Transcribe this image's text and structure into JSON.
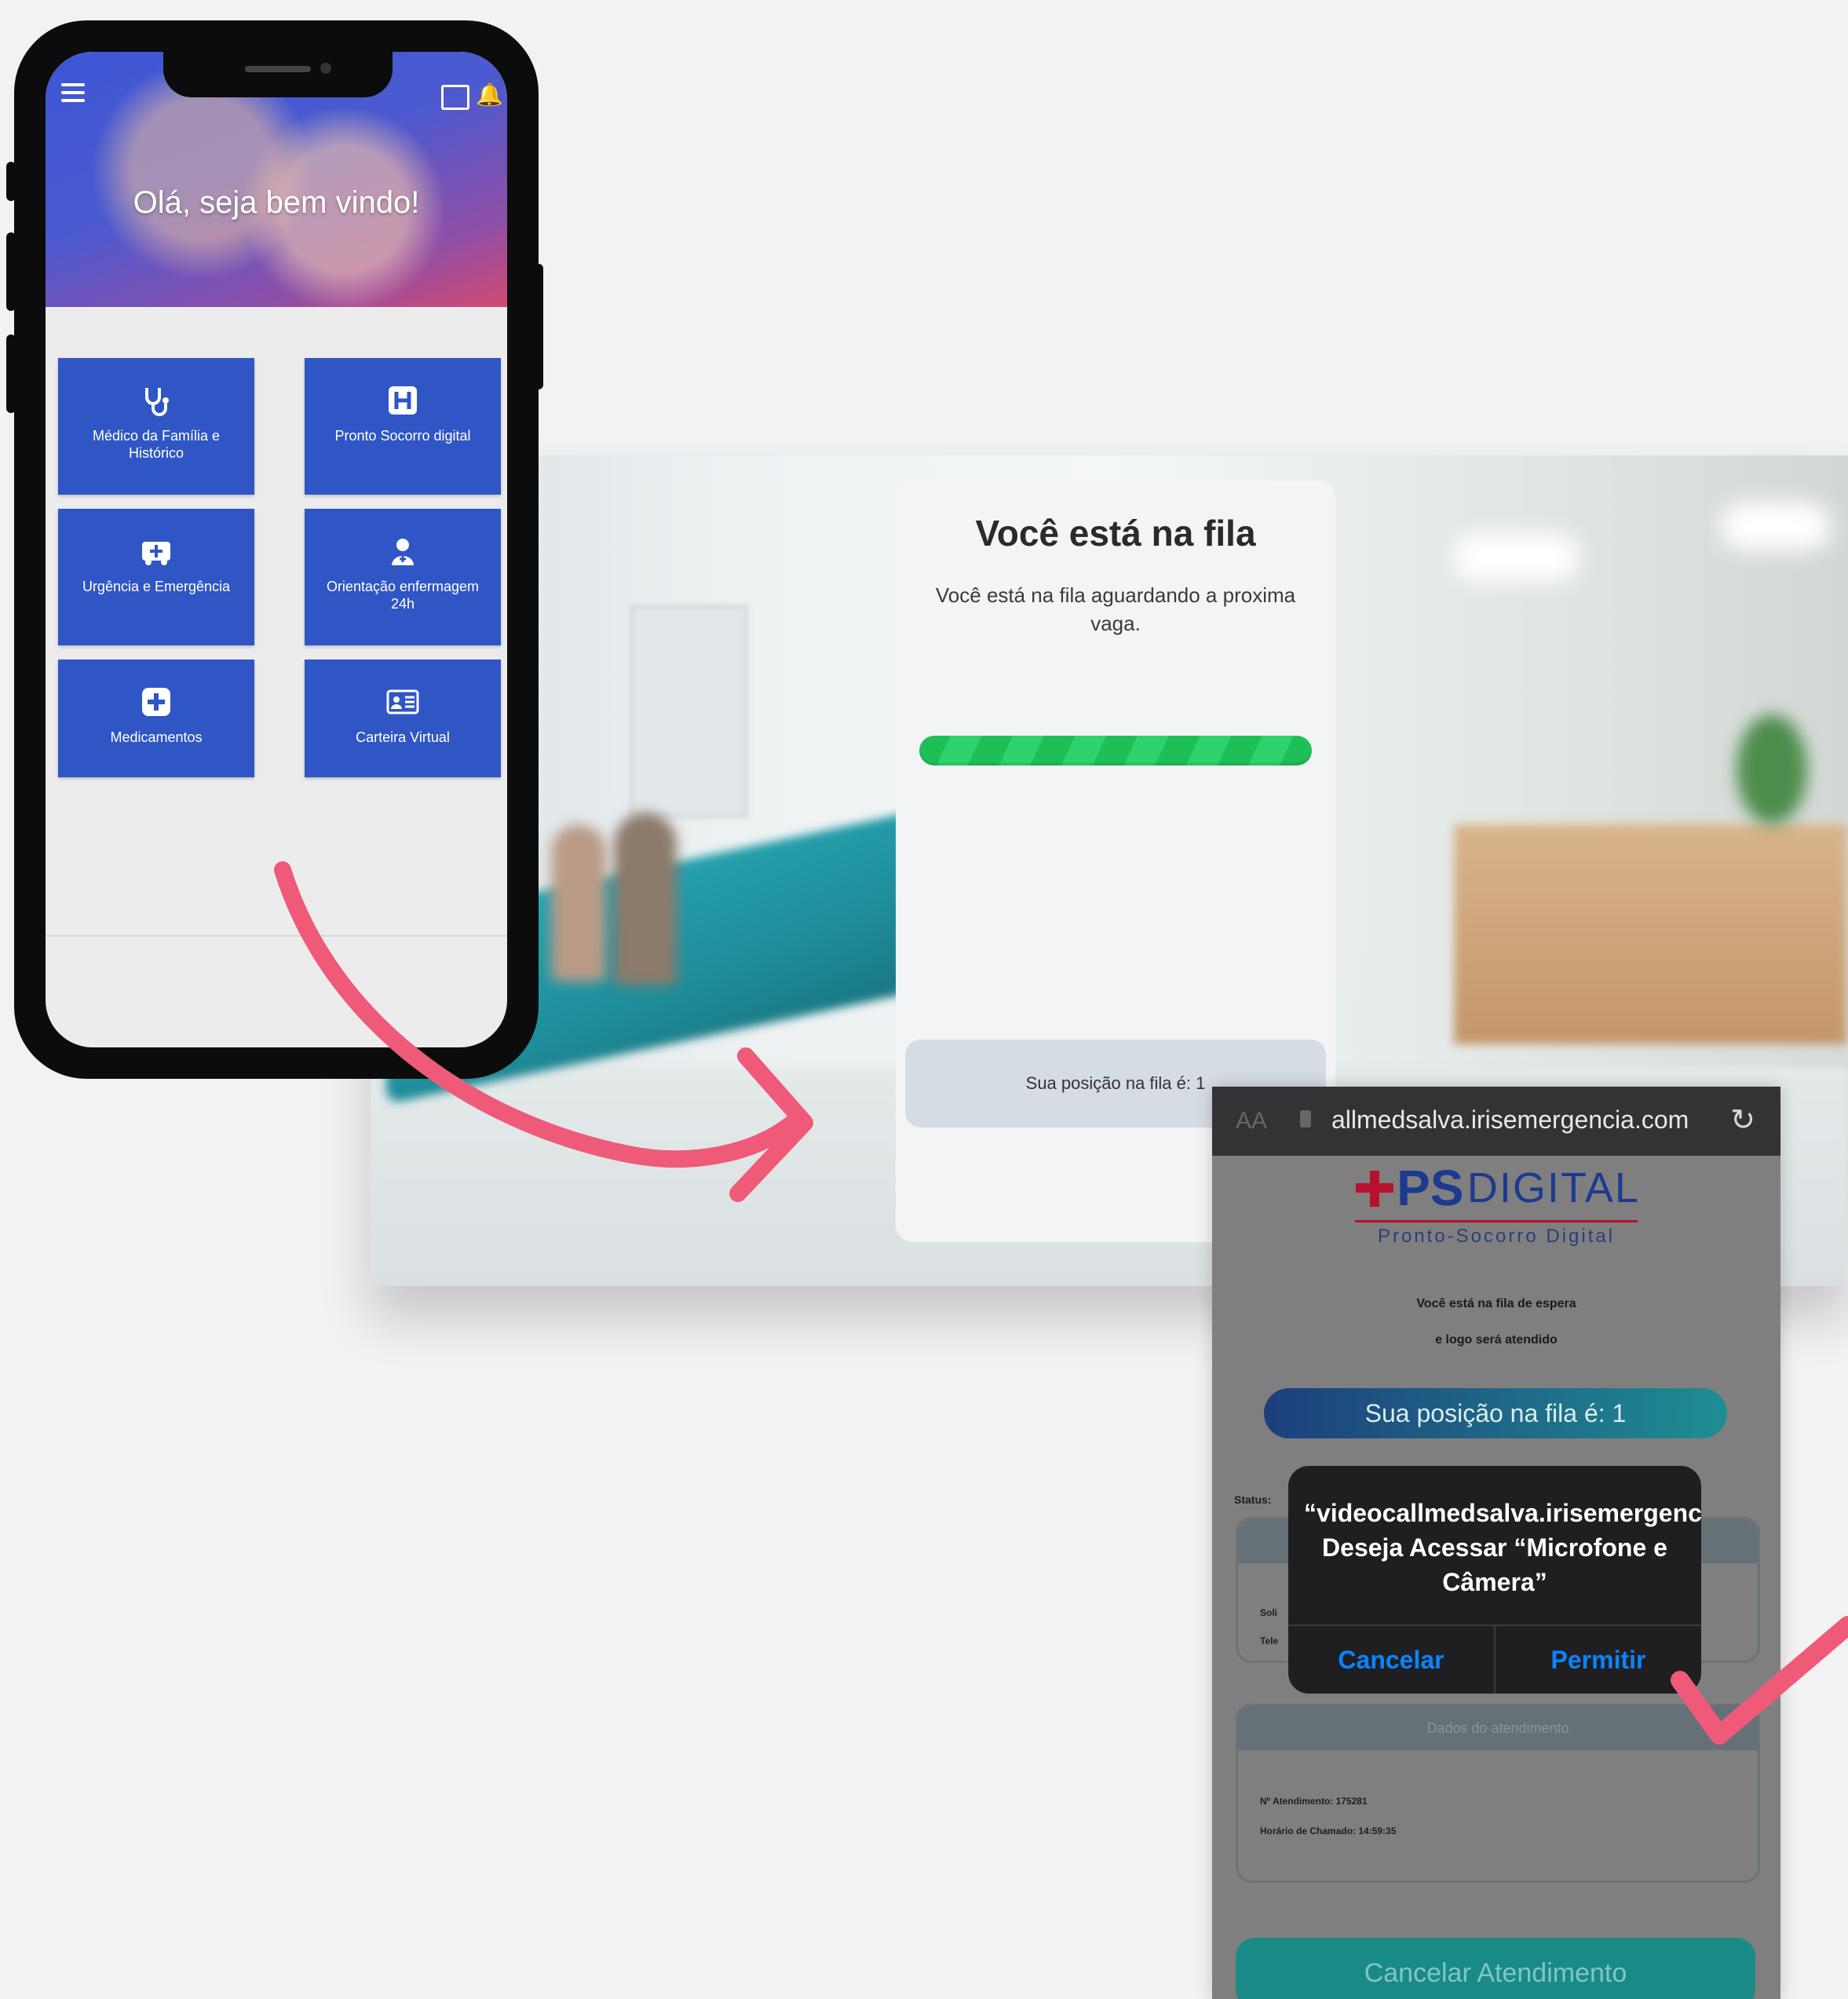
{
  "phone": {
    "greeting": "Olá, seja bem vindo!",
    "tiles": [
      {
        "label": "Médico da Família e Histórico",
        "icon": "stethoscope-icon"
      },
      {
        "label": "Pronto Socorro digital",
        "icon": "hospital-icon"
      },
      {
        "label": "Urgência e Emergência",
        "icon": "ambulance-icon"
      },
      {
        "label": "Orientação enfermagem 24h",
        "icon": "nurse-icon"
      },
      {
        "label": "Medicamentos",
        "icon": "medicine-plus-icon"
      },
      {
        "label": "Carteira Virtual",
        "icon": "id-card-icon"
      }
    ]
  },
  "queue_card": {
    "title": "Você está na fila",
    "description": "Você está na fila aguardando a proxima vaga.",
    "position_text": "Sua posição na fila é: 1"
  },
  "mobile": {
    "url": "allmedsalva.irisemergencia.com",
    "url_prefix": "AA",
    "logo": {
      "ps": "PS",
      "digital": "DIGITAL",
      "subtitle": "Pronto-Socorro Digital"
    },
    "line1": "Você está na fila de espera",
    "line2": "e logo será atendido",
    "position_button": "Sua posição na fila é: 1",
    "status_label": "Status:",
    "box1": {
      "row1": "Soli",
      "row2": "Tele"
    },
    "box2": {
      "header": "Dados do atendimento",
      "row1": "Nº Atendimento: 175281",
      "row2": "Horário de Chamado: 14:59:35"
    },
    "cancel_button": "Cancelar Atendimento",
    "dialog": {
      "message": "“videocallmedsalva.irisemergencia.com” Deseja Acessar “Microfone e Câmera”",
      "cancel": "Cancelar",
      "allow": "Permitir"
    }
  },
  "colors": {
    "tile_blue": "#2f56c4",
    "arrow_pink": "#ef5a78",
    "ios_blue": "#0a84ff",
    "progress_green": "#1fbf58"
  }
}
